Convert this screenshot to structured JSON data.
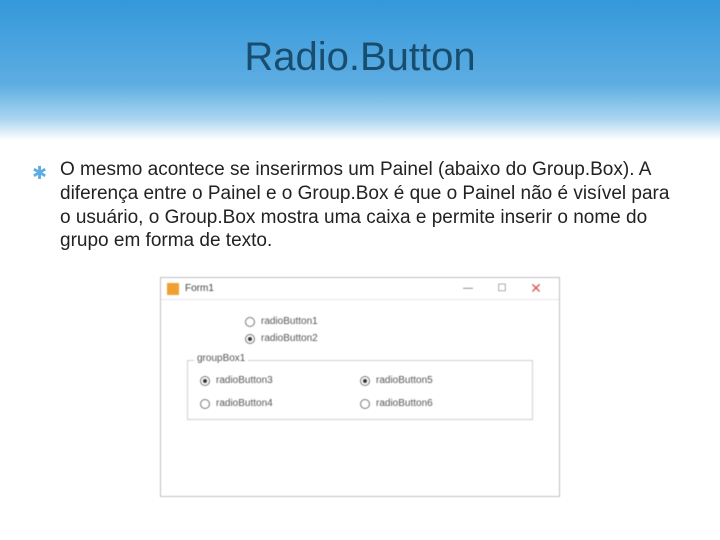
{
  "slide": {
    "title": "Radio.Button",
    "bullet": "O mesmo acontece se inserirmos um Painel (abaixo do Group.Box). A diferença entre o Painel e o Group.Box é que o Painel não é visível para o usuário, o Group.Box mostra uma caixa e permite inserir o nome do grupo em forma de texto."
  },
  "form": {
    "title": "Form1",
    "window_controls": {
      "min": "—",
      "max": "☐",
      "close": "✕"
    },
    "panel_radios": [
      {
        "label": "radioButton1",
        "checked": false
      },
      {
        "label": "radioButton2",
        "checked": true
      }
    ],
    "groupbox": {
      "label": "groupBox1",
      "radios": [
        {
          "label": "radioButton3",
          "checked": true
        },
        {
          "label": "radioButton5",
          "checked": true
        },
        {
          "label": "radioButton4",
          "checked": false
        },
        {
          "label": "radioButton6",
          "checked": false
        }
      ]
    }
  }
}
